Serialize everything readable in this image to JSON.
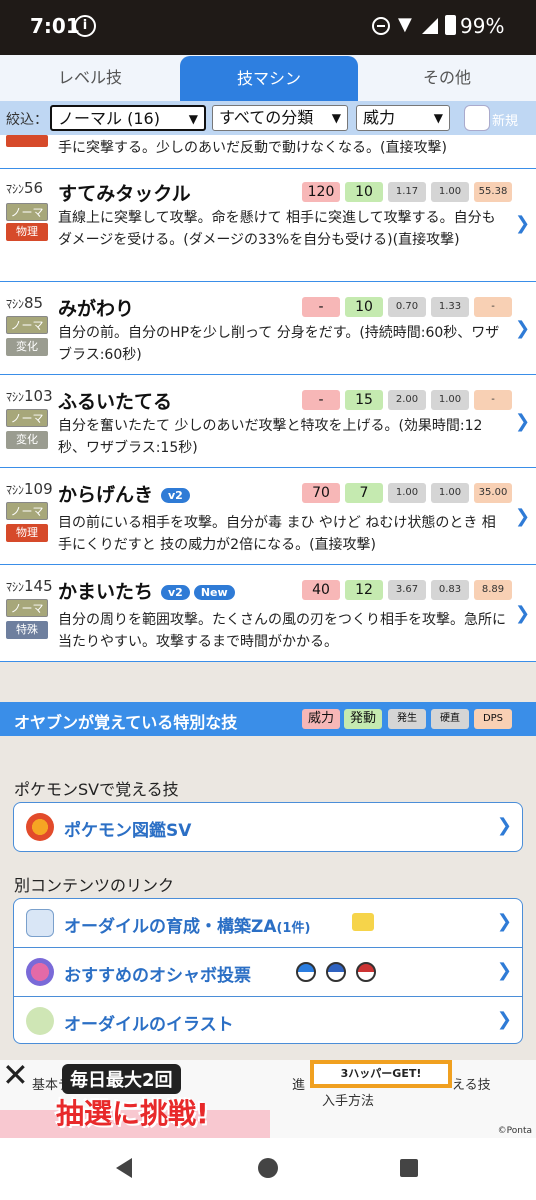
{
  "status_bar": {
    "time": "7:01",
    "battery": "99%"
  },
  "tabs": [
    {
      "label": "レベル技"
    },
    {
      "label": "技マシン"
    },
    {
      "label": "その他"
    }
  ],
  "filters": {
    "label": "絞込：",
    "type_select": "ノーマル (16)",
    "category_select": "すべての分類",
    "sort_select": "威力",
    "new_label": "新規"
  },
  "partial_row": {
    "desc": "手に突撃する。少しのあいだ反動で動けなくなる。(直接攻撃)"
  },
  "moves": [
    {
      "prefix": "ﾏｼﾝ",
      "num": "56",
      "type": "ノーマル",
      "category": "物理",
      "name": "すてみタックル",
      "power": "120",
      "activation": "10",
      "s1": "1.17",
      "s2": "1.00",
      "s3": "55.38",
      "desc": "直線上に突撃して攻撃。命を懸けて 相手に突進して攻撃する。自分もダメージを受ける。(ダメージの33%を自分も受ける)(直接攻撃)"
    },
    {
      "prefix": "ﾏｼﾝ",
      "num": "85",
      "type": "ノーマル",
      "category": "変化",
      "name": "みがわり",
      "power": "-",
      "activation": "10",
      "s1": "0.70",
      "s2": "1.33",
      "s3": "-",
      "desc": "自分の前。自分のHPを少し削って 分身をだす。(持続時間:60秒、ワザブラス:60秒)"
    },
    {
      "prefix": "ﾏｼﾝ",
      "num": "103",
      "type": "ノーマル",
      "category": "変化",
      "name": "ふるいたてる",
      "power": "-",
      "activation": "15",
      "s1": "2.00",
      "s2": "1.00",
      "s3": "-",
      "desc": "自分を奮いたたて 少しのあいだ攻撃と特攻を上げる。(効果時間:12秒、ワザブラス:15秒)"
    },
    {
      "prefix": "ﾏｼﾝ",
      "num": "109",
      "type": "ノーマル",
      "category": "物理",
      "name": "からげんき",
      "badge": "v2",
      "power": "70",
      "activation": "7",
      "s1": "1.00",
      "s2": "1.00",
      "s3": "35.00",
      "desc": "目の前にいる相手を攻撃。自分が毒 まひ やけど ねむけ状態のとき 相手にくりだすと 技の威力が2倍になる。(直接攻撃)"
    },
    {
      "prefix": "ﾏｼﾝ",
      "num": "145",
      "type": "ノーマル",
      "category": "特殊",
      "name": "かまいたち",
      "badge": "v2",
      "badge2": "New",
      "power": "40",
      "activation": "12",
      "s1": "3.67",
      "s2": "0.83",
      "s3": "8.89",
      "desc": "自分の周りを範囲攻撃。たくさんの風の刃をつくり相手を攻撃。急所に当たりやすい。攻撃するまで時間がかかる。"
    }
  ],
  "special_section": {
    "title": "オヤブンが覚えている特別な技",
    "legend": [
      "威力",
      "発動",
      "発生",
      "硬直",
      "DPS"
    ]
  },
  "sv_section": {
    "heading": "ポケモンSVで覚える技",
    "link": "ポケモン図鑑SV"
  },
  "links_section": {
    "heading": "別コンテンツのリンク",
    "items": [
      {
        "label": "オーダイルの育成・構築ZA",
        "suffix": "(1件)"
      },
      {
        "label": "おすすめのオシャボ投票"
      },
      {
        "label": "オーダイルのイラスト"
      }
    ]
  },
  "ad": {
    "close": "✕",
    "promo": "毎日最大2回",
    "big": "抽選に挑戦!",
    "get": "3ハッパーGET!",
    "nav1": "基本デー",
    "nav2": "進",
    "nav3": "入手方法",
    "nav4": "える技",
    "ponta": "©Ponta"
  },
  "colors": {
    "accent": "#2e7fe0",
    "row_border": "#3a8ee8",
    "filter_bg": "#bfd7f3"
  }
}
